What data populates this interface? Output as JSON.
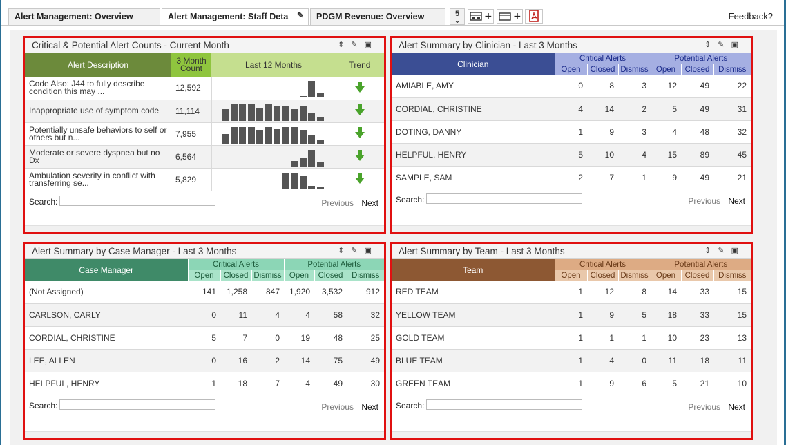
{
  "tabs": [
    {
      "label": "Alert Management: Overview",
      "active": false
    },
    {
      "label": "Alert Management: Staff Deta",
      "active": true
    },
    {
      "label": "PDGM Revenue: Overview",
      "active": false
    }
  ],
  "tab_count": "5",
  "feedback": "Feedback?",
  "search_label": "Search:",
  "prev_label": "Previous",
  "next_label": "Next",
  "alerts_panel": {
    "title": "Critical & Potential Alert Counts - Current Month",
    "headers": {
      "desc": "Alert Description",
      "count": "3 Month Count",
      "last12": "Last 12 Months",
      "trend": "Trend"
    },
    "rows": [
      {
        "desc": "Code Also: J44 to fully describe condition this may ...",
        "count": "12,592",
        "spark": [
          0,
          0,
          0,
          0,
          0,
          0,
          0,
          0,
          0,
          0.1,
          1,
          0.25
        ]
      },
      {
        "desc": "Inappropriate use of symptom code",
        "count": "11,114",
        "spark": [
          0.7,
          1,
          1,
          1,
          0.75,
          1,
          0.9,
          0.9,
          0.7,
          0.9,
          0.45,
          0.2
        ]
      },
      {
        "desc": "Potentially unsafe behaviors to self or others but n...",
        "count": "7,955",
        "spark": [
          0.6,
          1,
          1,
          1,
          0.85,
          1,
          0.9,
          1,
          1,
          0.85,
          0.5,
          0.2
        ]
      },
      {
        "desc": "Moderate or severe dyspnea but no Dx",
        "count": "6,564",
        "spark": [
          0,
          0,
          0,
          0,
          0,
          0,
          0,
          0,
          0.35,
          0.55,
          1,
          0.3
        ]
      },
      {
        "desc": "Ambulation severity in conflict with transferring se...",
        "count": "5,829",
        "spark": [
          0,
          0,
          0,
          0,
          0,
          0,
          0,
          0.95,
          1,
          0.85,
          0.2,
          0.15
        ]
      }
    ]
  },
  "clinician_panel": {
    "title": "Alert Summary by Clinician - Last 3 Months",
    "name_header": "Clinician",
    "group1": "Critical Alerts",
    "group2": "Potential Alerts",
    "subheaders": [
      "Open",
      "Closed",
      "Dismiss",
      "Open",
      "Closed",
      "Dismiss"
    ],
    "rows": [
      {
        "name": "AMIABLE, AMY",
        "vals": [
          "0",
          "8",
          "3",
          "12",
          "49",
          "22"
        ]
      },
      {
        "name": "CORDIAL, CHRISTINE",
        "vals": [
          "4",
          "14",
          "2",
          "5",
          "49",
          "31"
        ]
      },
      {
        "name": "DOTING, DANNY",
        "vals": [
          "1",
          "9",
          "3",
          "4",
          "48",
          "32"
        ]
      },
      {
        "name": "HELPFUL, HENRY",
        "vals": [
          "5",
          "10",
          "4",
          "15",
          "89",
          "45"
        ]
      },
      {
        "name": "SAMPLE, SAM",
        "vals": [
          "2",
          "7",
          "1",
          "9",
          "49",
          "21"
        ]
      }
    ]
  },
  "case_manager_panel": {
    "title": "Alert Summary by Case Manager - Last 3 Months",
    "name_header": "Case Manager",
    "group1": "Critical Alerts",
    "group2": "Potential Alerts",
    "subheaders": [
      "Open",
      "Closed",
      "Dismiss",
      "Open",
      "Closed",
      "Dismiss"
    ],
    "rows": [
      {
        "name": "(Not Assigned)",
        "vals": [
          "141",
          "1,258",
          "847",
          "1,920",
          "3,532",
          "912"
        ]
      },
      {
        "name": "CARLSON, CARLY",
        "vals": [
          "0",
          "11",
          "4",
          "4",
          "58",
          "32"
        ]
      },
      {
        "name": "CORDIAL, CHRISTINE",
        "vals": [
          "5",
          "7",
          "0",
          "19",
          "48",
          "25"
        ]
      },
      {
        "name": "LEE, ALLEN",
        "vals": [
          "0",
          "16",
          "2",
          "14",
          "75",
          "49"
        ]
      },
      {
        "name": "HELPFUL, HENRY",
        "vals": [
          "1",
          "18",
          "7",
          "4",
          "49",
          "30"
        ]
      }
    ]
  },
  "team_panel": {
    "title": "Alert Summary by Team - Last 3 Months",
    "name_header": "Team",
    "group1": "Critical Alerts",
    "group2": "Potential Alerts",
    "subheaders": [
      "Open",
      "Closed",
      "Dismiss",
      "Open",
      "Closed",
      "Dismiss"
    ],
    "rows": [
      {
        "name": "RED TEAM",
        "vals": [
          "1",
          "12",
          "8",
          "14",
          "33",
          "15"
        ]
      },
      {
        "name": "YELLOW TEAM",
        "vals": [
          "1",
          "9",
          "5",
          "18",
          "33",
          "15"
        ]
      },
      {
        "name": "GOLD TEAM",
        "vals": [
          "1",
          "1",
          "1",
          "10",
          "23",
          "13"
        ]
      },
      {
        "name": "BLUE TEAM",
        "vals": [
          "1",
          "4",
          "0",
          "11",
          "18",
          "11"
        ]
      },
      {
        "name": "GREEN TEAM",
        "vals": [
          "1",
          "9",
          "6",
          "5",
          "21",
          "10"
        ]
      }
    ]
  },
  "colors": {
    "highlight_border": "#e01010",
    "trend_arrow": "#4aa32b"
  },
  "icons": [
    "resize-icon",
    "edit-icon",
    "maximize-icon",
    "add-dashboard-icon",
    "add-widget-icon",
    "pdf-icon",
    "chevron-down-icon",
    "pencil-icon",
    "trend-down-icon"
  ]
}
